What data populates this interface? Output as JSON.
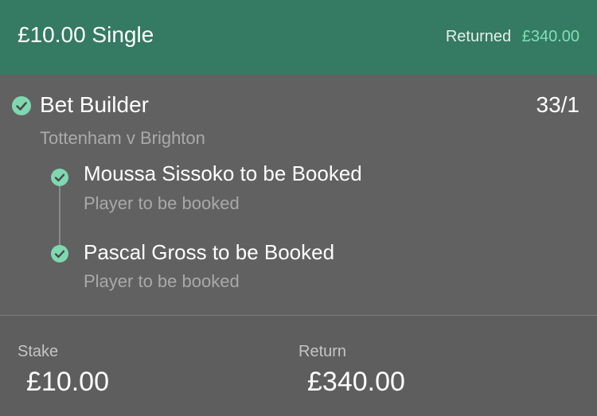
{
  "header": {
    "title": "£10.00 Single",
    "returned_label": "Returned",
    "returned_amount": "£340.00"
  },
  "bet": {
    "type": "Bet Builder",
    "odds": "33/1",
    "event": "Tottenham v Brighton",
    "status_icon": "check-circle-icon",
    "legs": [
      {
        "title": "Moussa Sissoko to be Booked",
        "market": "Player to be booked",
        "status_icon": "check-circle-icon"
      },
      {
        "title": "Pascal Gross to be Booked",
        "market": "Player to be booked",
        "status_icon": "check-circle-icon"
      }
    ]
  },
  "footer": {
    "stake_label": "Stake",
    "stake_value": "£10.00",
    "return_label": "Return",
    "return_value": "£340.00"
  },
  "colors": {
    "header_bg": "#357a63",
    "accent_green": "#7fe0b8",
    "check_green": "#7fd8b2",
    "body_bg": "#616161"
  }
}
